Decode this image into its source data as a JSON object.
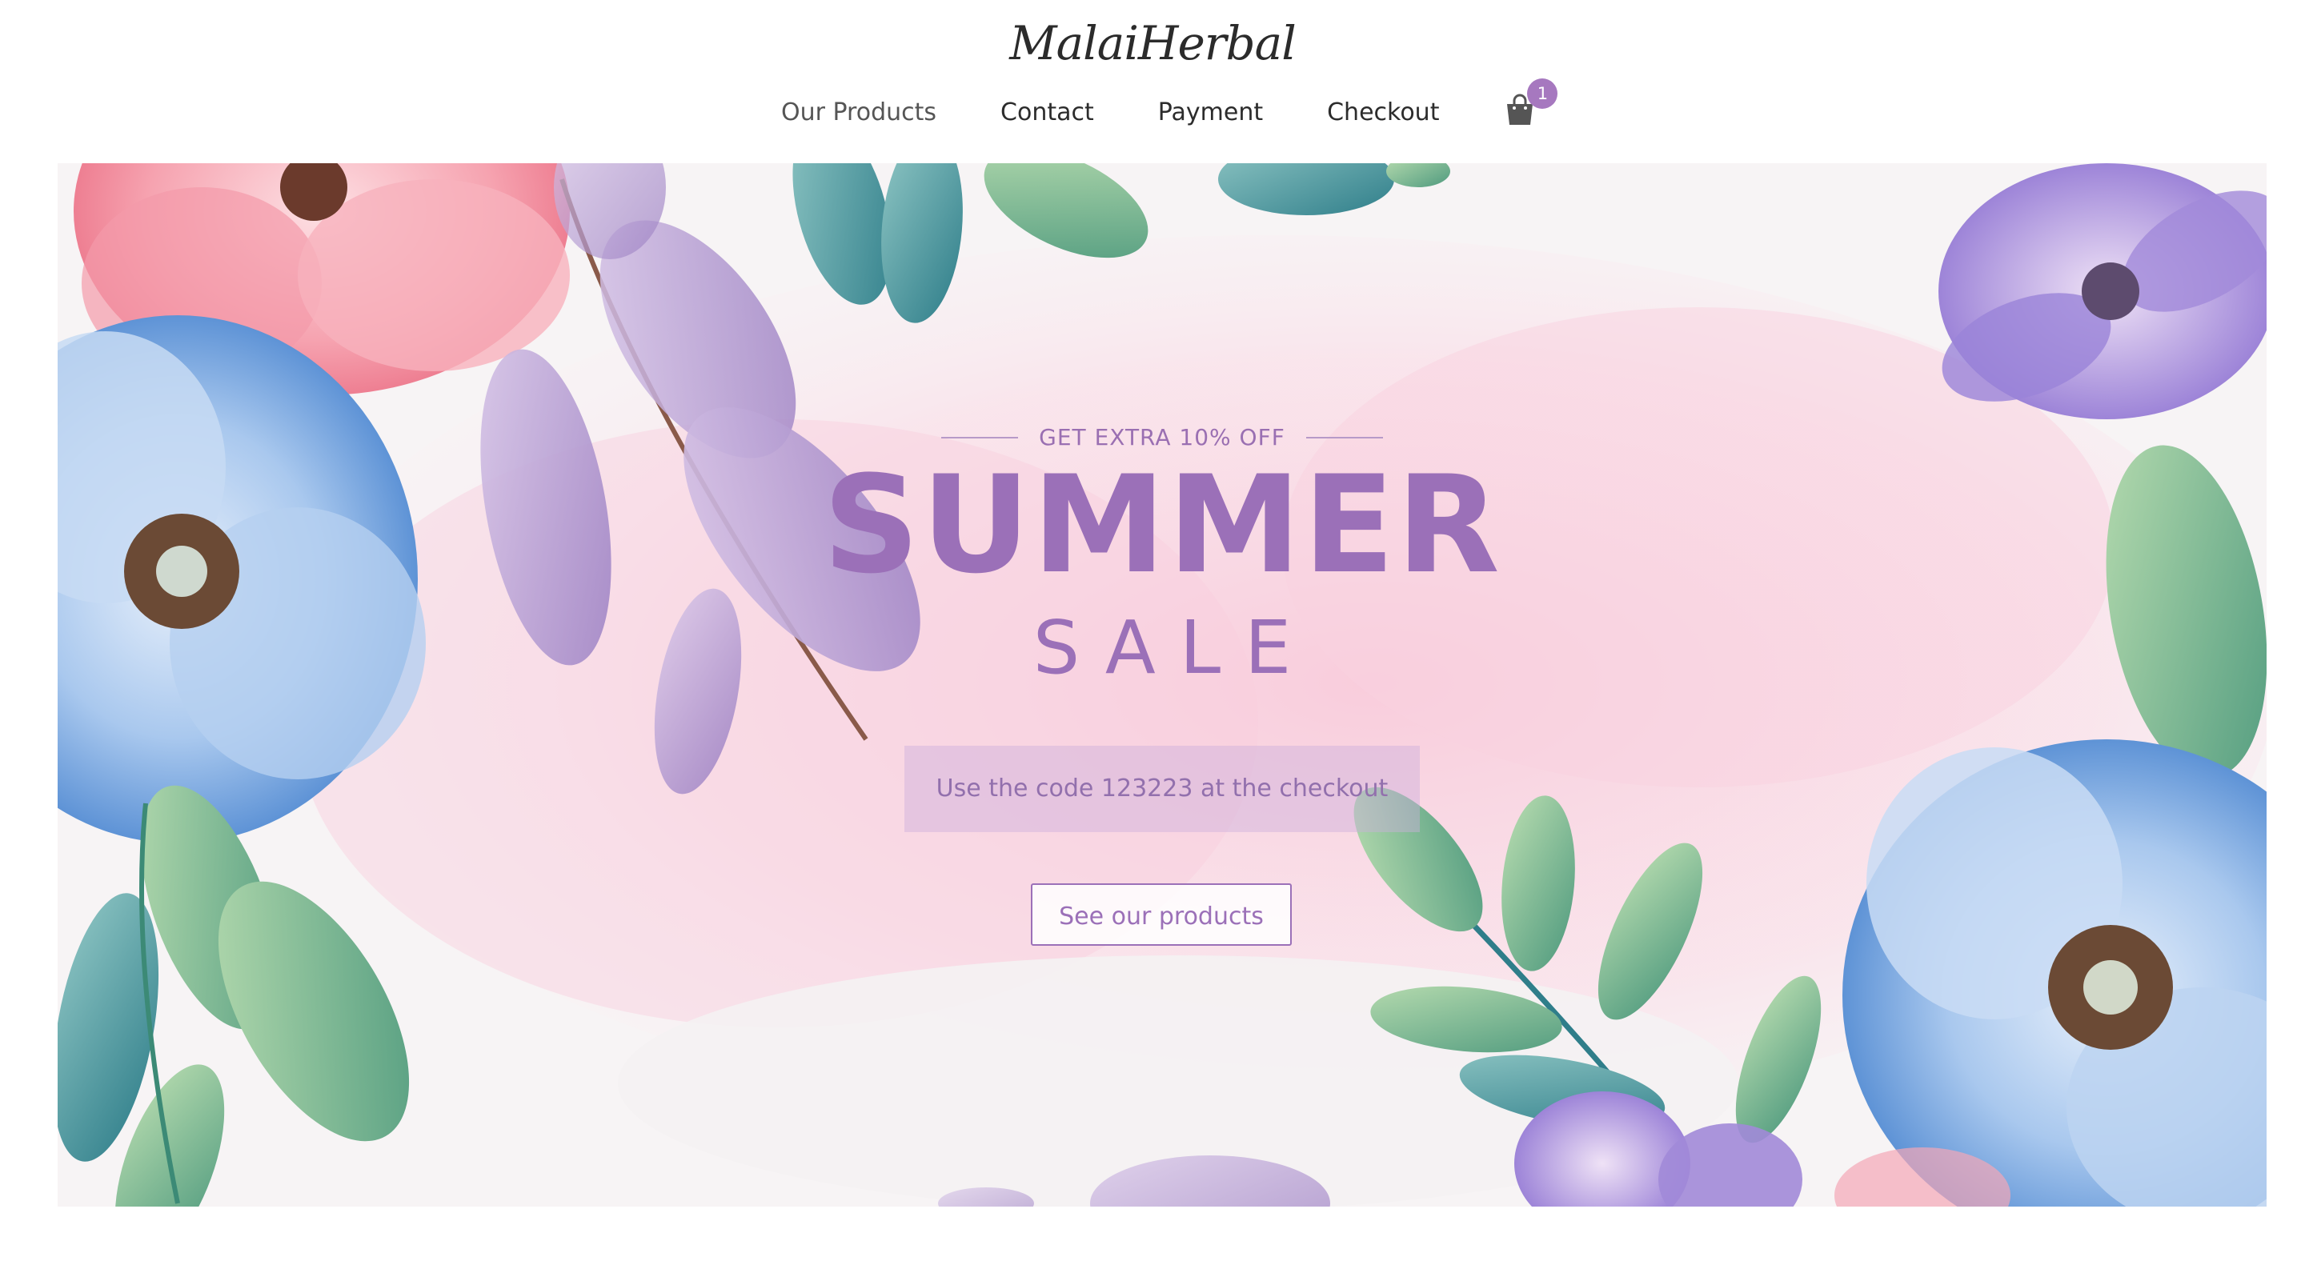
{
  "brand": {
    "logo_text": "MalaiHerbal"
  },
  "nav": {
    "items": [
      {
        "label": "Our Products"
      },
      {
        "label": "Contact"
      },
      {
        "label": "Payment"
      },
      {
        "label": "Checkout"
      }
    ],
    "cart": {
      "icon": "shopping-bag-icon",
      "count": "1"
    }
  },
  "hero": {
    "eyebrow": "GET EXTRA 10% OFF",
    "headline": "SUMMER",
    "subheadline": "SALE",
    "code_text": "Use the code 123223 at the checkout",
    "cta_label": "See our products"
  },
  "colors": {
    "accent": "#9b70b8",
    "badge": "#a678bf",
    "text": "#2c2c2c"
  }
}
